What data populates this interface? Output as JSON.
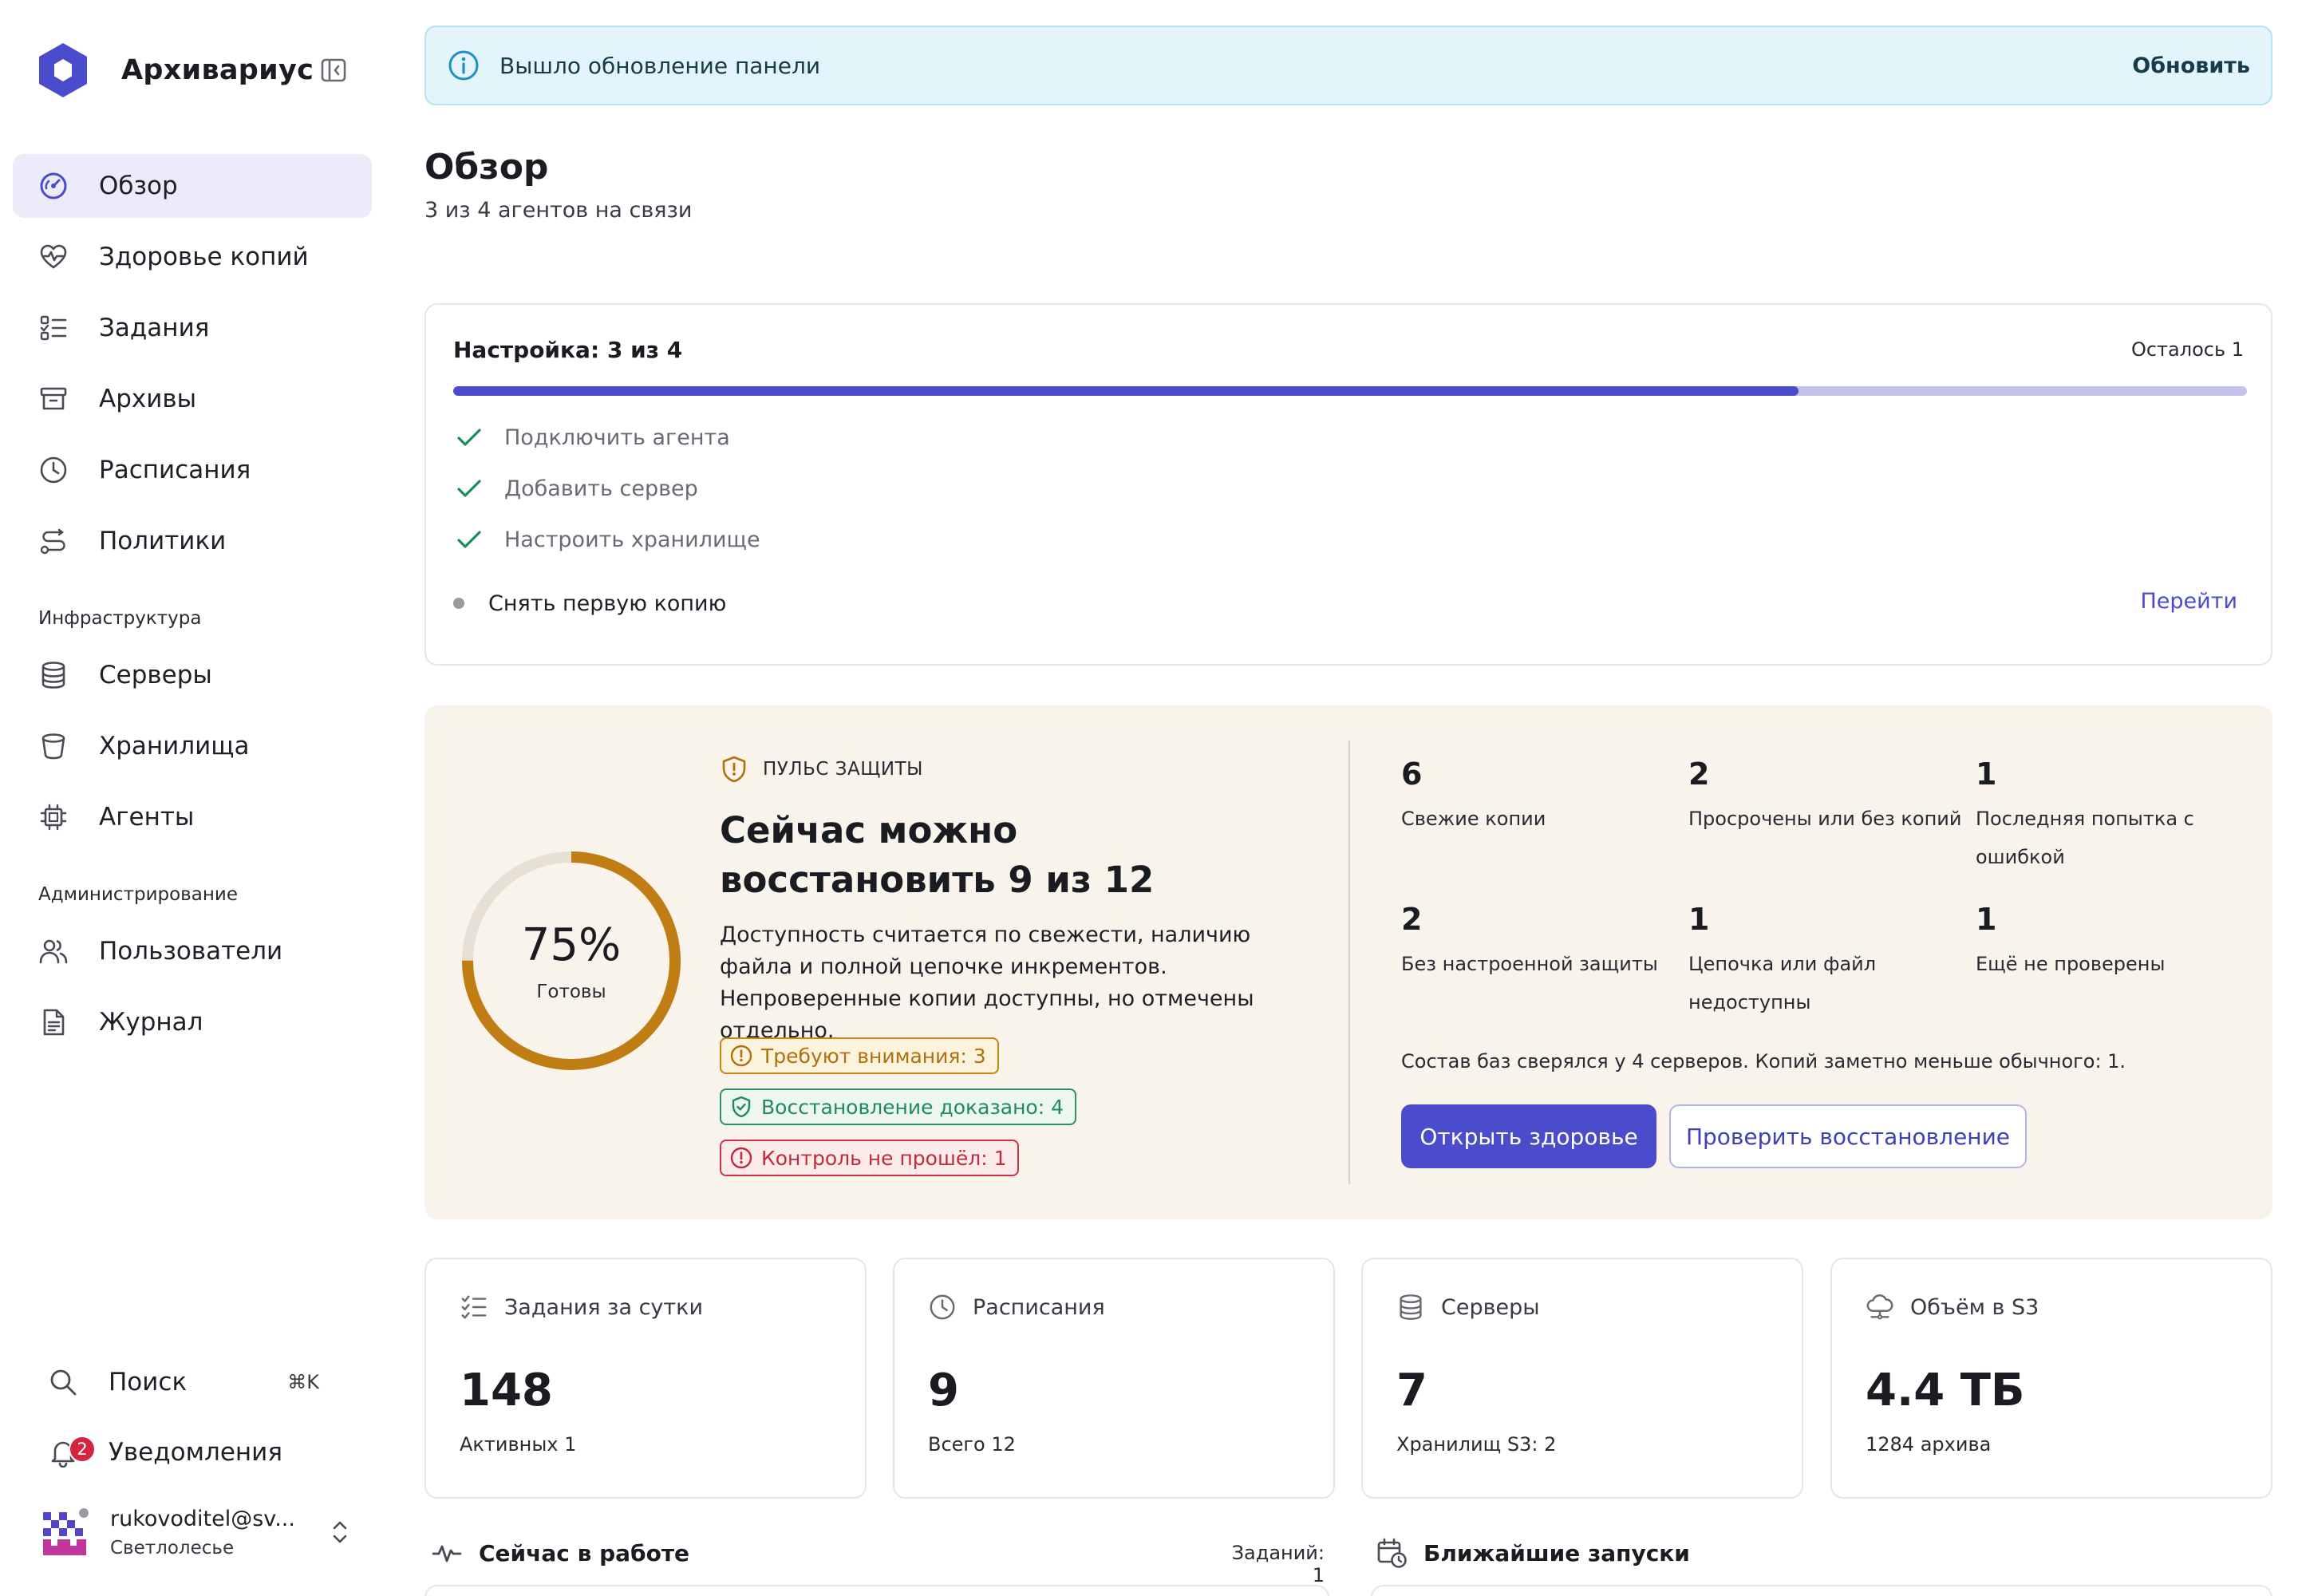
{
  "app": {
    "name": "Архивариус"
  },
  "nav": {
    "items": [
      {
        "label": "Обзор",
        "icon": "gauge-icon",
        "active": true
      },
      {
        "label": "Здоровье копий",
        "icon": "heart-pulse-icon"
      },
      {
        "label": "Задания",
        "icon": "list-checks-icon"
      },
      {
        "label": "Архивы",
        "icon": "archive-box-icon"
      },
      {
        "label": "Расписания",
        "icon": "clock-icon"
      },
      {
        "label": "Политики",
        "icon": "route-icon"
      }
    ],
    "infra_heading": "Инфраструктура",
    "infra_items": [
      {
        "label": "Серверы",
        "icon": "database-icon"
      },
      {
        "label": "Хранилища",
        "icon": "bucket-icon"
      },
      {
        "label": "Агенты",
        "icon": "chip-icon"
      }
    ],
    "admin_heading": "Администрирование",
    "admin_items": [
      {
        "label": "Пользователи",
        "icon": "users-icon"
      },
      {
        "label": "Журнал",
        "icon": "document-icon"
      }
    ]
  },
  "sidebar_bottom": {
    "search_label": "Поиск",
    "search_shortcut": "⌘K",
    "notifications_label": "Уведомления",
    "notifications_count": "2",
    "user_email": "rukovoditel@sv...",
    "user_org": "Светлолесье"
  },
  "banner": {
    "text": "Вышло обновление панели",
    "action": "Обновить"
  },
  "page": {
    "title": "Обзор",
    "subtitle": "3 из 4 агентов на связи"
  },
  "setup": {
    "title": "Настройка: 3 из 4",
    "remaining": "Осталось 1",
    "progress_fraction": 0.75,
    "steps_done": [
      "Подключить агента",
      "Добавить сервер",
      "Настроить хранилище"
    ],
    "step_pending": "Снять первую копию",
    "step_link": "Перейти"
  },
  "pulse": {
    "kicker": "ПУЛЬС ЗАЩИТЫ",
    "headline": "Сейчас можно восстановить 9 из 12",
    "description": "Доступность считается по свежести, наличию файла и полной цепочке инкрементов. Непроверенные копии доступны, но отмечены отдельно.",
    "ready_percent": "75%",
    "ready_fraction": 0.75,
    "ready_label": "Готовы",
    "pills": {
      "warn": "Требуют внимания: 3",
      "ok": "Восстановление доказано: 4",
      "err": "Контроль не прошёл: 1"
    },
    "metrics": [
      {
        "value": "6",
        "label": "Свежие копии"
      },
      {
        "value": "2",
        "label": "Просрочены или без копий"
      },
      {
        "value": "1",
        "label": "Последняя попытка с ошибкой"
      },
      {
        "value": "2",
        "label": "Без настроенной защиты"
      },
      {
        "value": "1",
        "label": "Цепочка или файл недоступны"
      },
      {
        "value": "1",
        "label": "Ещё не проверены"
      }
    ],
    "note": "Состав баз сверялся у 4 серверов. Копий заметно меньше обычного: 1.",
    "primary_button": "Открыть здоровье",
    "secondary_button": "Проверить восстановление"
  },
  "stats": [
    {
      "title": "Задания за сутки",
      "value": "148",
      "sub": "Активных 1",
      "icon": "list-checks-icon"
    },
    {
      "title": "Расписания",
      "value": "9",
      "sub": "Всего 12",
      "icon": "clock-icon"
    },
    {
      "title": "Серверы",
      "value": "7",
      "sub": "Хранилищ S3: 2",
      "icon": "database-icon"
    },
    {
      "title": "Объём в S3",
      "value": "4.4 ТБ",
      "sub": "1284 архива",
      "icon": "cloud-icon"
    }
  ],
  "running": {
    "title": "Сейчас в работе",
    "count": "Заданий: 1"
  },
  "upcoming": {
    "title": "Ближайшие запуски"
  },
  "colors": {
    "accent": "#4a4ccc",
    "accent_light": "#ebebfa",
    "banner_bg": "#e4f4fb",
    "pulse_bg": "#f8f4ec",
    "gauge": "#c07d14",
    "success": "#1f8a5c",
    "warning": "#b0700a",
    "danger": "#c12a3e"
  }
}
